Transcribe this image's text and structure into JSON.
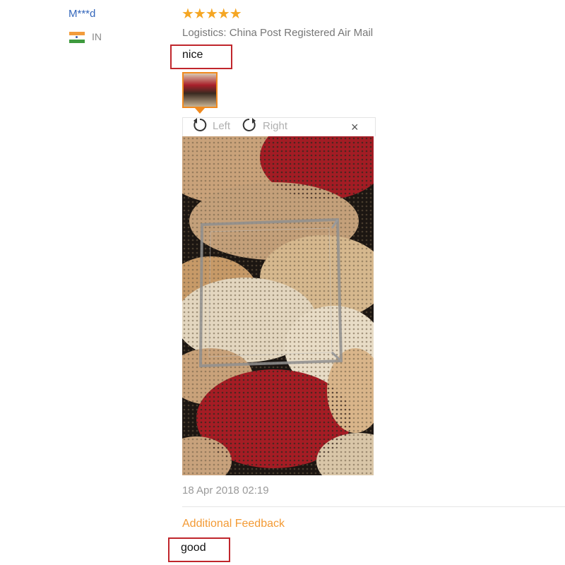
{
  "review": {
    "user": "M***d",
    "country": "IN",
    "rating": "★★★★★",
    "logistics": "Logistics: China Post Registered Air Mail",
    "comment": "nice",
    "timestamp": "18 Apr 2018 02:19",
    "additional_feedback_title": "Additional Feedback",
    "additional_feedback": "good"
  },
  "viewer": {
    "rotate_left_label": "Left",
    "rotate_right_label": "Right",
    "close_label": "×"
  },
  "colors": {
    "accent_orange": "#f39a34",
    "star_color": "#f5a623",
    "highlight_box": "#c0262c",
    "username_link": "#3366bb"
  },
  "icons": {
    "flag": "india-flag-icon",
    "rotate_left": "rotate-left-icon",
    "rotate_right": "rotate-right-icon",
    "close": "close-icon"
  }
}
